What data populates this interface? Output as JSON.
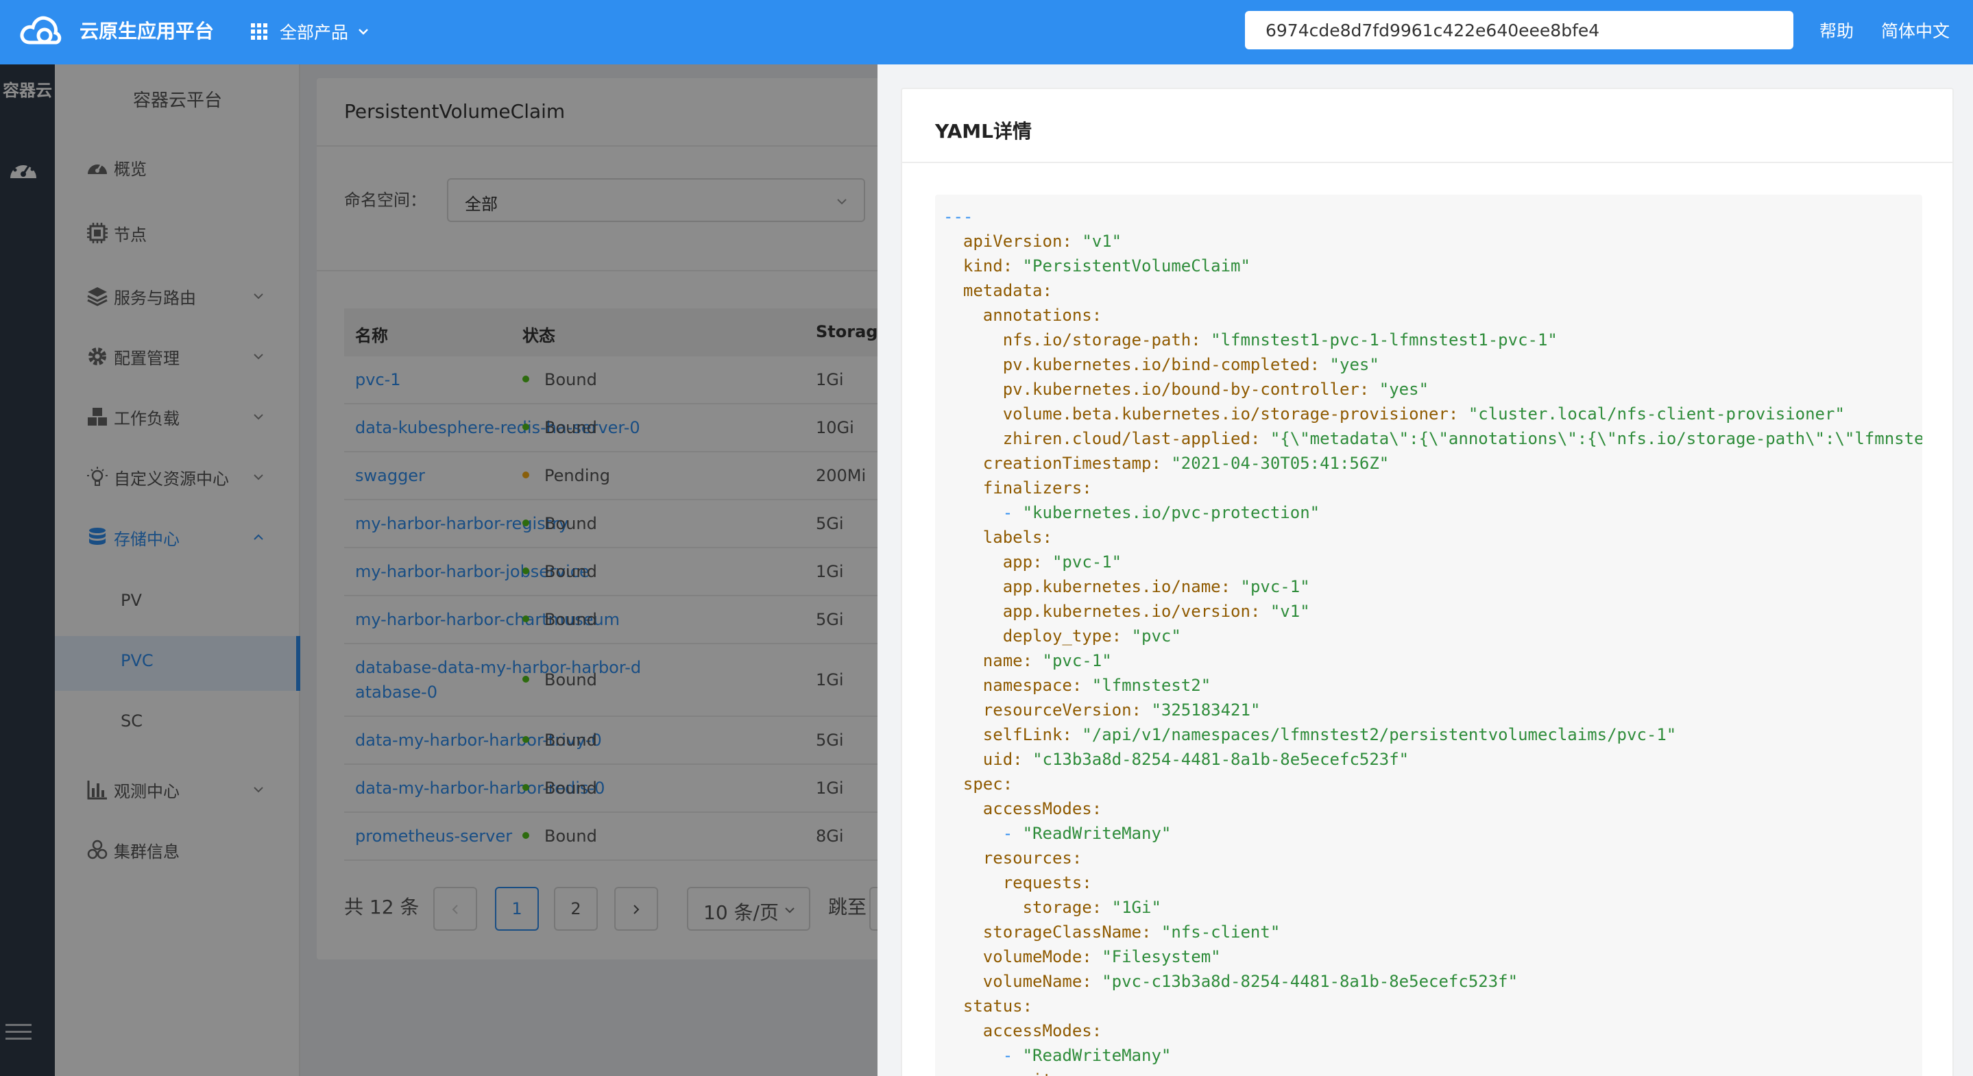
{
  "topbar": {
    "brand": "云原生应用平台",
    "apps_label": "全部产品",
    "search_value": "6974cde8d7fd9961c422e640eee8bfe4",
    "help": "帮助",
    "language": "简体中文"
  },
  "rail": {
    "title": "容器云"
  },
  "sidebar": {
    "title": "容器云平台",
    "items": [
      {
        "label": "概览",
        "icon": "gauge-icon"
      },
      {
        "label": "节点",
        "icon": "chip-icon"
      },
      {
        "label": "服务与路由",
        "icon": "layers-icon"
      },
      {
        "label": "配置管理",
        "icon": "gear-icon"
      },
      {
        "label": "工作负载",
        "icon": "cubes-icon"
      },
      {
        "label": "自定义资源中心",
        "icon": "lightbulb-icon"
      },
      {
        "label": "存储中心",
        "icon": "database-icon"
      },
      {
        "label": "观测中心",
        "icon": "bar-chart-icon"
      },
      {
        "label": "集群信息",
        "icon": "cluster-icon"
      }
    ],
    "storage_sub": [
      "PV",
      "PVC",
      "SC"
    ]
  },
  "content": {
    "title": "PersistentVolumeClaim",
    "namespace_label": "命名空间：",
    "namespace_value": "全部",
    "columns": {
      "name": "名称",
      "status": "状态",
      "storage": "Storage"
    },
    "rows": [
      {
        "name": "pvc-1",
        "status": "Bound",
        "storage": "1Gi"
      },
      {
        "name": "data-kubesphere-redis-ha-server-0",
        "status": "Bound",
        "storage": "10Gi"
      },
      {
        "name": "swagger",
        "status": "Pending",
        "storage": "200Mi"
      },
      {
        "name": "my-harbor-harbor-registry",
        "status": "Bound",
        "storage": "5Gi"
      },
      {
        "name": "my-harbor-harbor-jobservice",
        "status": "Bound",
        "storage": "1Gi"
      },
      {
        "name": "my-harbor-harbor-chartmuseum",
        "status": "Bound",
        "storage": "5Gi"
      },
      {
        "name_line1": "database-data-my-harbor-harbor-d",
        "name_line2": "atabase-0",
        "status": "Bound",
        "storage": "1Gi"
      },
      {
        "name": "data-my-harbor-harbor-trivy-0",
        "status": "Bound",
        "storage": "5Gi"
      },
      {
        "name": "data-my-harbor-harbor-redis-0",
        "status": "Bound",
        "storage": "1Gi"
      },
      {
        "name": "prometheus-server",
        "status": "Bound",
        "storage": "8Gi"
      }
    ],
    "pager": {
      "total": "共 12 条",
      "pages": [
        "1",
        "2"
      ],
      "page_size": "10 条/页",
      "jump_label": "跳至"
    }
  },
  "yaml": {
    "title": "YAML详情",
    "lines": [
      {
        "indent": "",
        "doc": "---"
      },
      {
        "indent": "  ",
        "key": "apiVersion",
        "value": "\"v1\""
      },
      {
        "indent": "  ",
        "key": "kind",
        "value": "\"PersistentVolumeClaim\""
      },
      {
        "indent": "  ",
        "key": "metadata",
        "value": ""
      },
      {
        "indent": "    ",
        "key": "annotations",
        "value": ""
      },
      {
        "indent": "      ",
        "key": "nfs.io/storage-path",
        "value": "\"lfmnstest1-pvc-1-lfmnstest1-pvc-1\""
      },
      {
        "indent": "      ",
        "key": "pv.kubernetes.io/bind-completed",
        "value": "\"yes\""
      },
      {
        "indent": "      ",
        "key": "pv.kubernetes.io/bound-by-controller",
        "value": "\"yes\""
      },
      {
        "indent": "      ",
        "key": "volume.beta.kubernetes.io/storage-provisioner",
        "value": "\"cluster.local/nfs-client-provisioner\""
      },
      {
        "indent": "      ",
        "key": "zhiren.cloud/last-applied",
        "value": "\"{\\\"metadata\\\":{\\\"annotations\\\":{\\\"nfs.io/storage-path\\\":\\\"lfmnste"
      },
      {
        "indent": "    ",
        "key": "creationTimestamp",
        "value": "\"2021-04-30T05:41:56Z\""
      },
      {
        "indent": "    ",
        "key": "finalizers",
        "value": ""
      },
      {
        "indent": "      ",
        "dash": "- ",
        "value": "\"kubernetes.io/pvc-protection\""
      },
      {
        "indent": "    ",
        "key": "labels",
        "value": ""
      },
      {
        "indent": "      ",
        "key": "app",
        "value": "\"pvc-1\""
      },
      {
        "indent": "      ",
        "key": "app.kubernetes.io/name",
        "value": "\"pvc-1\""
      },
      {
        "indent": "      ",
        "key": "app.kubernetes.io/version",
        "value": "\"v1\""
      },
      {
        "indent": "      ",
        "key": "deploy_type",
        "value": "\"pvc\""
      },
      {
        "indent": "    ",
        "key": "name",
        "value": "\"pvc-1\""
      },
      {
        "indent": "    ",
        "key": "namespace",
        "value": "\"lfmnstest2\""
      },
      {
        "indent": "    ",
        "key": "resourceVersion",
        "value": "\"325183421\""
      },
      {
        "indent": "    ",
        "key": "selfLink",
        "value": "\"/api/v1/namespaces/lfmnstest2/persistentvolumeclaims/pvc-1\""
      },
      {
        "indent": "    ",
        "key": "uid",
        "value": "\"c13b3a8d-8254-4481-8a1b-8e5ecefc523f\""
      },
      {
        "indent": "  ",
        "key": "spec",
        "value": ""
      },
      {
        "indent": "    ",
        "key": "accessModes",
        "value": ""
      },
      {
        "indent": "      ",
        "dash": "- ",
        "value": "\"ReadWriteMany\""
      },
      {
        "indent": "    ",
        "key": "resources",
        "value": ""
      },
      {
        "indent": "      ",
        "key": "requests",
        "value": ""
      },
      {
        "indent": "        ",
        "key": "storage",
        "value": "\"1Gi\""
      },
      {
        "indent": "    ",
        "key": "storageClassName",
        "value": "\"nfs-client\""
      },
      {
        "indent": "    ",
        "key": "volumeMode",
        "value": "\"Filesystem\""
      },
      {
        "indent": "    ",
        "key": "volumeName",
        "value": "\"pvc-c13b3a8d-8254-4481-8a1b-8e5ecefc523f\""
      },
      {
        "indent": "  ",
        "key": "status",
        "value": ""
      },
      {
        "indent": "    ",
        "key": "accessModes",
        "value": ""
      },
      {
        "indent": "      ",
        "dash": "- ",
        "value": "\"ReadWriteMany\""
      },
      {
        "indent": "    ",
        "key": "capacity",
        "value": ""
      }
    ]
  },
  "colors": {
    "brand_blue": "#2f8ef0",
    "rail_dark": "#313b49",
    "status_bound": "#52c41a",
    "status_pending": "#faad14",
    "yaml_key": "#8f5a00",
    "yaml_string": "#2e8c3a"
  }
}
